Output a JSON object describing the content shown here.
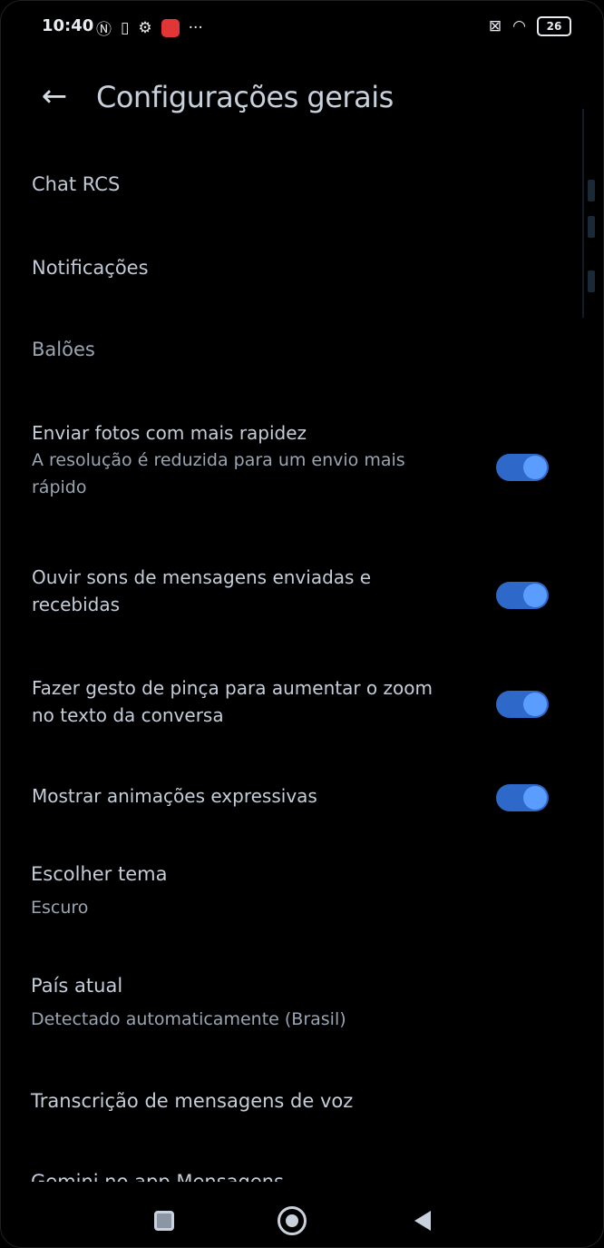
{
  "status_bar": {
    "time": "10:40",
    "battery": "26",
    "icons": [
      "nfc-icon",
      "sim-icon",
      "settings-gear-icon",
      "app-notification-icon",
      "more-dots-icon",
      "sim-x-icon",
      "wifi-icon",
      "battery-icon"
    ]
  },
  "header": {
    "back_glyph": "←",
    "title": "Configurações gerais"
  },
  "menu": {
    "chat_rcs": "Chat RCS",
    "notifications": "Notificações"
  },
  "section": {
    "bubbles": "Balões"
  },
  "toggles": [
    {
      "title": "Enviar fotos com mais rapidez",
      "subtitle": "A resolução é reduzida para um envio mais rápido",
      "on": true
    },
    {
      "title": "Ouvir sons de mensagens enviadas e recebidas",
      "on": true
    },
    {
      "title": "Fazer gesto de pinça para aumentar o zoom no texto da conversa",
      "on": true
    },
    {
      "title": "Mostrar animações expressivas",
      "on": true
    }
  ],
  "settings": {
    "theme_title": "Escolher tema",
    "theme_value": "Escuro",
    "country_title": "País atual",
    "country_value": "Detectado automaticamente (Brasil)",
    "transcription_title": "Transcrição de mensagens de voz",
    "gemini_title": "Gemini no app Mensagens"
  },
  "colors": {
    "background": "#000000",
    "toggle_track": "#2e68c8",
    "toggle_knob": "#5b9cff",
    "text_primary": "#c4cdd8",
    "text_secondary": "#9aa5b3"
  }
}
